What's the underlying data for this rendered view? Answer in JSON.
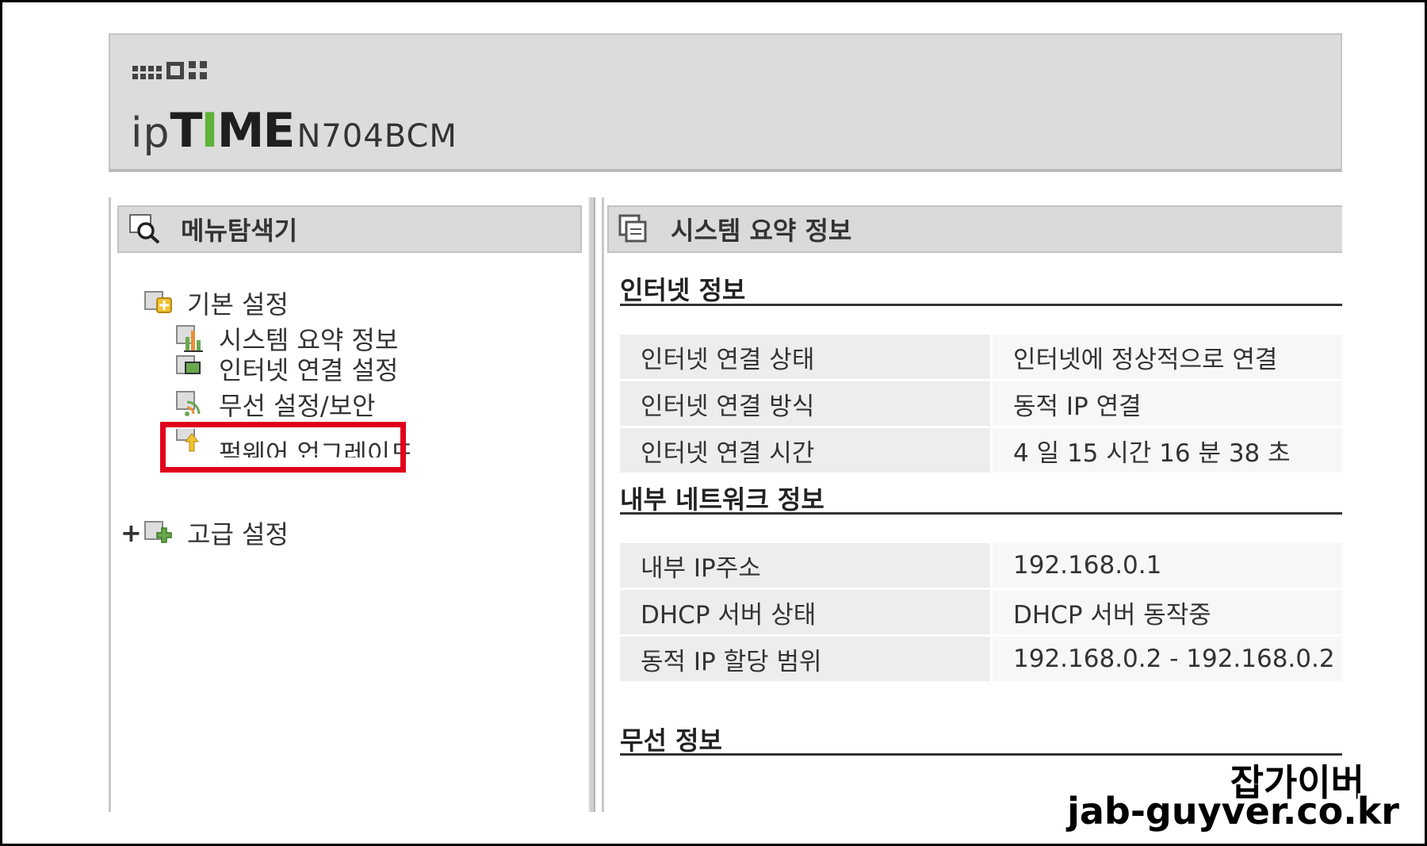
{
  "header": {
    "logo_ip": "ip",
    "logo_time_parts": [
      "T",
      "I",
      "ME"
    ],
    "model": "N704BCM"
  },
  "left_panel": {
    "title": "메뉴탐색기",
    "tree": {
      "basic": "기본 설정",
      "basic_children": [
        "시스템 요약 정보",
        "인터넷 연결 설정",
        "무선 설정/보안",
        "펌웨어 업그레이드"
      ],
      "advanced_toggle": "+",
      "advanced": "고급 설정"
    },
    "highlighted_item": "무선 설정/보안"
  },
  "right_panel": {
    "title": "시스템 요약 정보",
    "sections": {
      "internet": {
        "title": "인터넷 정보",
        "rows": [
          {
            "label": "인터넷 연결 상태",
            "value": "인터넷에 정상적으로 연결"
          },
          {
            "label": "인터넷 연결 방식",
            "value": "동적 IP 연결"
          },
          {
            "label": "인터넷 연결 시간",
            "value": "4 일 15 시간 16 분 38 초"
          }
        ]
      },
      "internal": {
        "title": "내부 네트워크 정보",
        "rows": [
          {
            "label": "내부 IP주소",
            "value": "192.168.0.1"
          },
          {
            "label": "DHCP 서버 상태",
            "value": "DHCP 서버 동작중"
          },
          {
            "label": "동적 IP 할당 범위",
            "value": "192.168.0.2 -  192.168.0.2"
          }
        ]
      },
      "wireless": {
        "title": "무선 정보"
      }
    }
  },
  "watermark": {
    "line1": "잡가이버",
    "line2": "jab-guyver.co.kr"
  },
  "colors": {
    "accent_green": "#5cb337",
    "highlight_red": "#e0001b",
    "header_bg": "#dcdcdc"
  }
}
